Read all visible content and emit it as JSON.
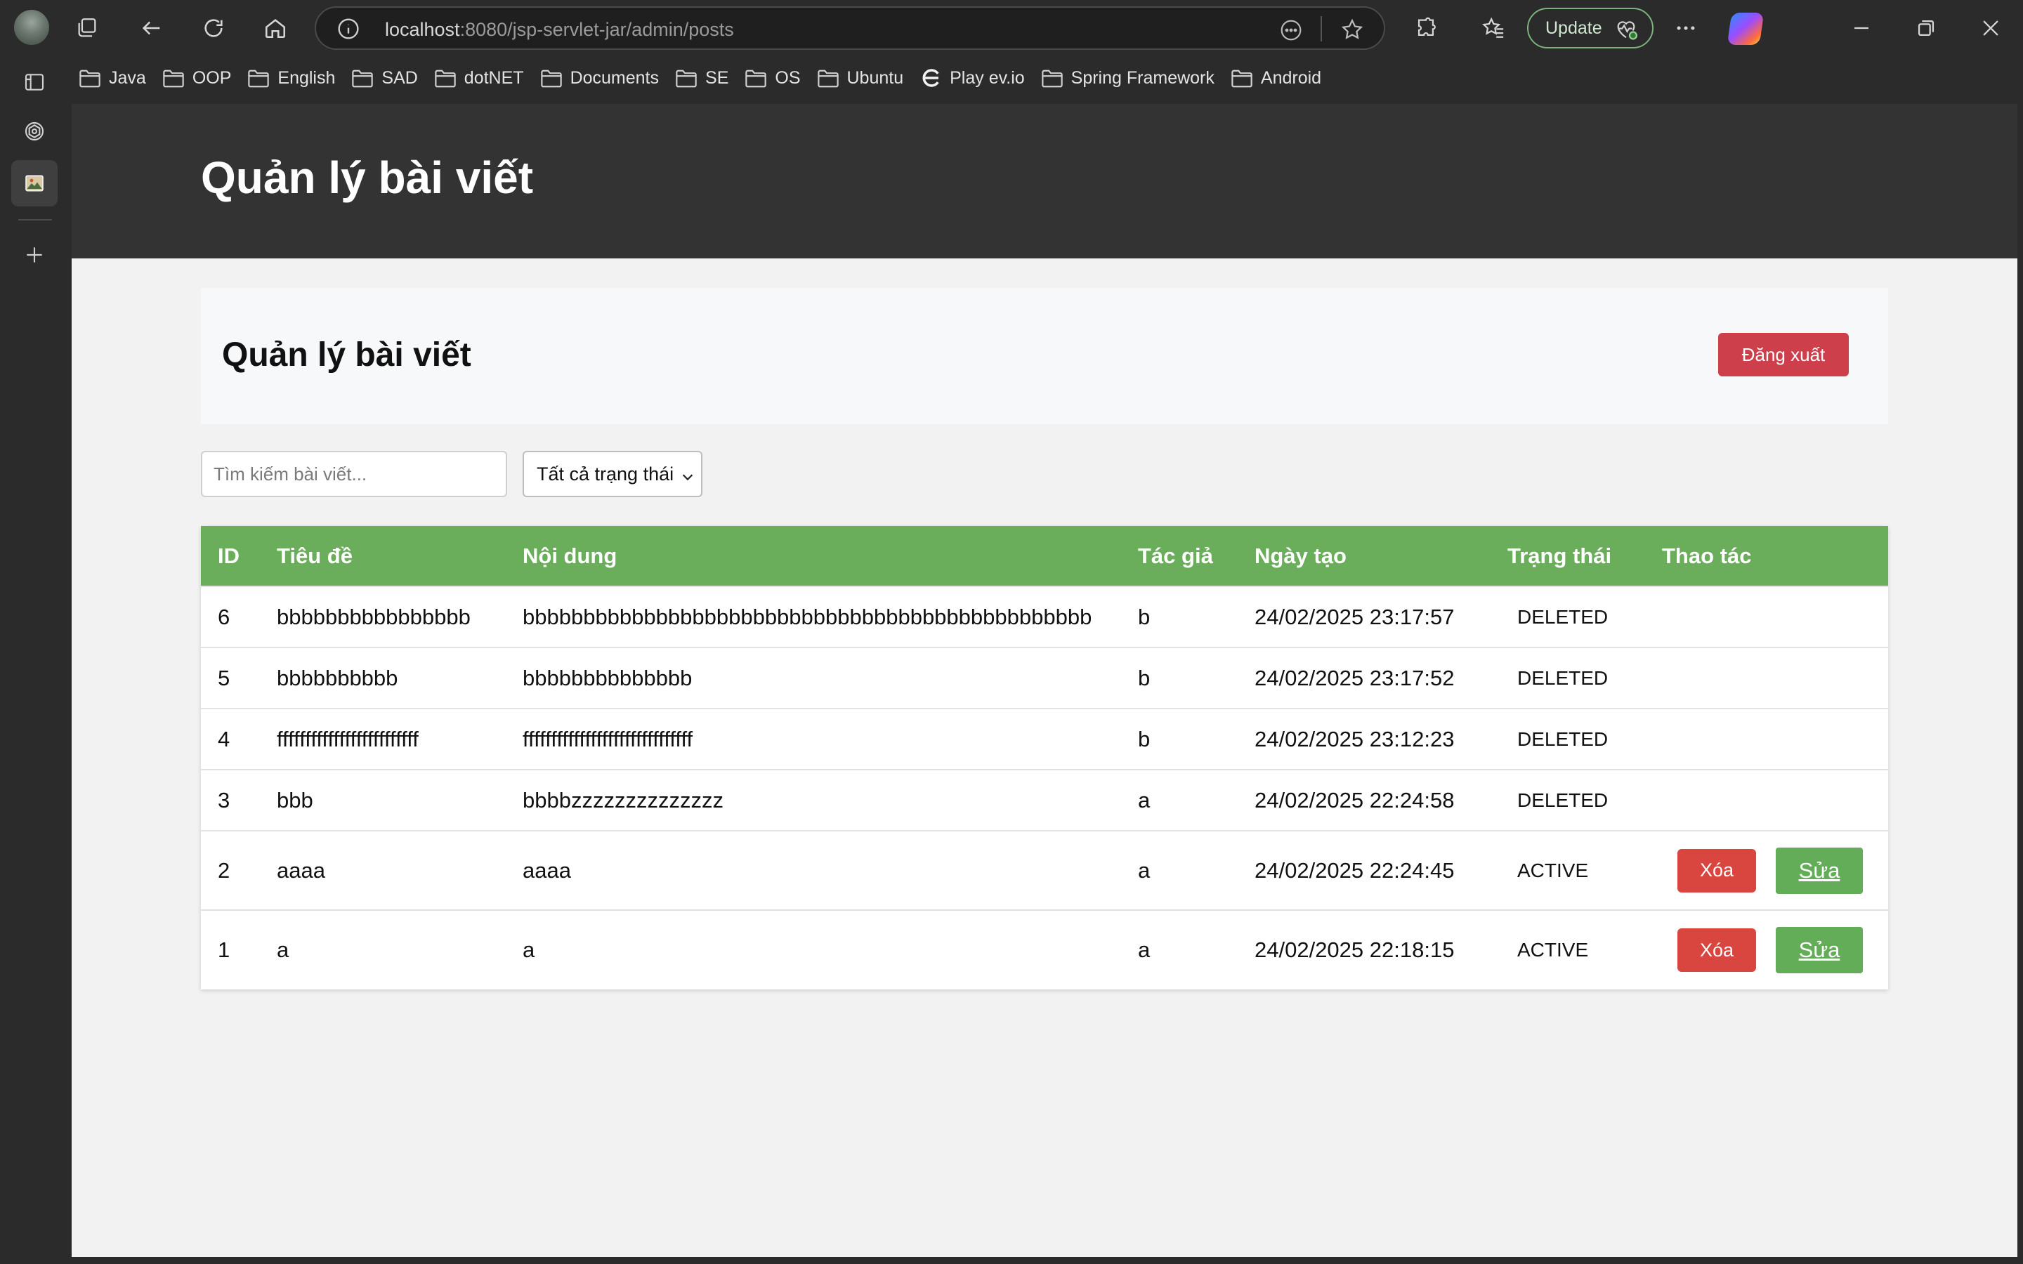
{
  "browser": {
    "url_host": "localhost",
    "url_path": ":8080/jsp-servlet-jar/admin/posts",
    "update_label": "Update",
    "bookmarks": [
      {
        "label": "Java",
        "icon": "folder-icon"
      },
      {
        "label": "OOP",
        "icon": "folder-icon"
      },
      {
        "label": "English",
        "icon": "folder-icon"
      },
      {
        "label": "SAD",
        "icon": "folder-icon"
      },
      {
        "label": "dotNET",
        "icon": "folder-icon"
      },
      {
        "label": "Documents",
        "icon": "folder-icon"
      },
      {
        "label": "SE",
        "icon": "folder-icon"
      },
      {
        "label": "OS",
        "icon": "folder-icon"
      },
      {
        "label": "Ubuntu",
        "icon": "folder-icon"
      },
      {
        "label": "Play ev.io",
        "icon": "evio-icon"
      },
      {
        "label": "Spring Framework",
        "icon": "folder-icon"
      },
      {
        "label": "Android",
        "icon": "folder-icon"
      }
    ]
  },
  "header": {
    "title": "Quản lý bài viết"
  },
  "card": {
    "title": "Quản lý bài viết",
    "logout_label": "Đăng xuất"
  },
  "filters": {
    "search_placeholder": "Tìm kiếm bài viết...",
    "status_selected": "Tất cả trạng thái"
  },
  "table": {
    "headers": {
      "id": "ID",
      "title": "Tiêu đề",
      "content": "Nội dung",
      "author": "Tác giả",
      "created": "Ngày tạo",
      "status": "Trạng thái",
      "actions": "Thao tác"
    },
    "delete_label": "Xóa",
    "edit_label": "Sửa",
    "rows": [
      {
        "id": "6",
        "title": "bbbbbbbbbbbbbbbb",
        "content": "bbbbbbbbbbbbbbbbbbbbbbbbbbbbbbbbbbbbbbbbbbbbbbb",
        "author": "b",
        "created": "24/02/2025 23:17:57",
        "status": "DELETED"
      },
      {
        "id": "5",
        "title": "bbbbbbbbbb",
        "content": "bbbbbbbbbbbbbb",
        "author": "b",
        "created": "24/02/2025 23:17:52",
        "status": "DELETED"
      },
      {
        "id": "4",
        "title": "fffffffffffffffffffffffff",
        "content": "ffffffffffffffffffffffffffffff",
        "author": "b",
        "created": "24/02/2025 23:12:23",
        "status": "DELETED"
      },
      {
        "id": "3",
        "title": "bbb",
        "content": "bbbbzzzzzzzzzzzzzz",
        "author": "a",
        "created": "24/02/2025 22:24:58",
        "status": "DELETED"
      },
      {
        "id": "2",
        "title": "aaaa",
        "content": "aaaa",
        "author": "a",
        "created": "24/02/2025 22:24:45",
        "status": "ACTIVE"
      },
      {
        "id": "1",
        "title": "a",
        "content": "a",
        "author": "a",
        "created": "24/02/2025 22:18:15",
        "status": "ACTIVE"
      }
    ]
  },
  "colors": {
    "header_bg": "#333333",
    "table_header_bg": "#6aad5b",
    "delete_button": "#d9463f",
    "edit_button": "#63ad59",
    "logout_button": "#cc3f4b"
  }
}
